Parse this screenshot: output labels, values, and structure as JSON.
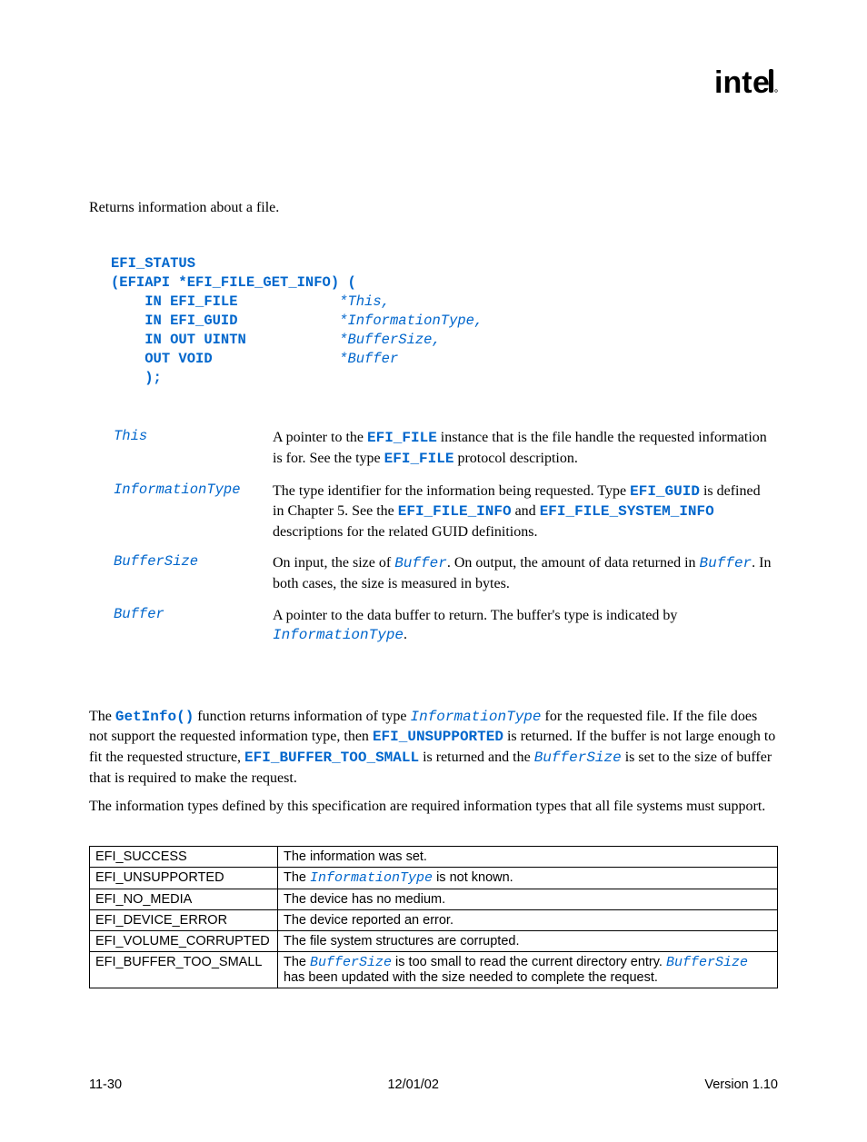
{
  "logo_alt": "intel",
  "summary": "Returns information about a file.",
  "prototype": {
    "line1": "EFI_STATUS",
    "line2": "(EFIAPI *EFI_FILE_GET_INFO) (",
    "args": [
      {
        "dir": "IN EFI_FILE",
        "name": "*This,"
      },
      {
        "dir": "IN EFI_GUID",
        "name": "*InformationType,"
      },
      {
        "dir": "IN OUT UINTN",
        "name": "*BufferSize,"
      },
      {
        "dir": "OUT VOID",
        "name": "*Buffer"
      }
    ],
    "close": ");"
  },
  "params": [
    {
      "name": "This",
      "d1": "A pointer to the ",
      "c1": "EFI_FILE",
      "d2": " instance that is the file handle the requested information is for.  See the type ",
      "c2": "EFI_FILE",
      "d3": " protocol description."
    },
    {
      "name": "InformationType",
      "d1": "The type identifier for the information being requested.    Type ",
      "c1": "EFI_GUID",
      "d2": " is defined in Chapter 5.  See the ",
      "c2": "EFI_FILE_INFO",
      "d3": " and ",
      "c3": "EFI_FILE_SYSTEM_INFO",
      "d4": " descriptions for the related GUID definitions."
    },
    {
      "name": "BufferSize",
      "d1": "On input, the size of ",
      "i1": "Buffer",
      "d2": ".  On output, the amount of data returned in ",
      "i2": "Buffer",
      "d3": ".  In both cases, the size is measured in bytes."
    },
    {
      "name": "Buffer",
      "d1": "A pointer to the data buffer to return.  The buffer's type is indicated by ",
      "i1": "InformationType",
      "d2": "."
    }
  ],
  "desc": {
    "p1a": "The ",
    "p1b": "GetInfo()",
    "p1c": " function returns information of type ",
    "p1d": "InformationType",
    "p1e": " for the requested file.  If the file does not support the requested information type, then ",
    "p1f": "EFI_UNSUPPORTED",
    "p1g": " is returned.  If the buffer is not large enough to fit the requested structure, ",
    "p1h": "EFI_BUFFER_TOO_SMALL",
    "p1i": "  is returned and the ",
    "p1j": "BufferSize",
    "p1k": "  is set to the size of buffer that is required to make the request.",
    "p2": "The information types defined by this specification are required information types that all file systems must support."
  },
  "status_codes": [
    {
      "code": "EFI_SUCCESS",
      "desc_a": "The information was set."
    },
    {
      "code": "EFI_UNSUPPORTED",
      "desc_a": "The ",
      "ita": "InformationType",
      "desc_b": " is not known."
    },
    {
      "code": "EFI_NO_MEDIA",
      "desc_a": "The device has no medium."
    },
    {
      "code": "EFI_DEVICE_ERROR",
      "desc_a": "The device reported an error."
    },
    {
      "code": "EFI_VOLUME_CORRUPTED",
      "desc_a": "The file system structures are corrupted."
    },
    {
      "code": "EFI_BUFFER_TOO_SMALL",
      "desc_a": "The ",
      "ita": "BufferSize",
      "desc_b": " is too small to read the current directory entry.  ",
      "ita2": "BufferSize",
      "desc_c": " has been updated with the size needed to complete the request."
    }
  ],
  "footer": {
    "left": "11-30",
    "center": "12/01/02",
    "right": "Version 1.10"
  }
}
